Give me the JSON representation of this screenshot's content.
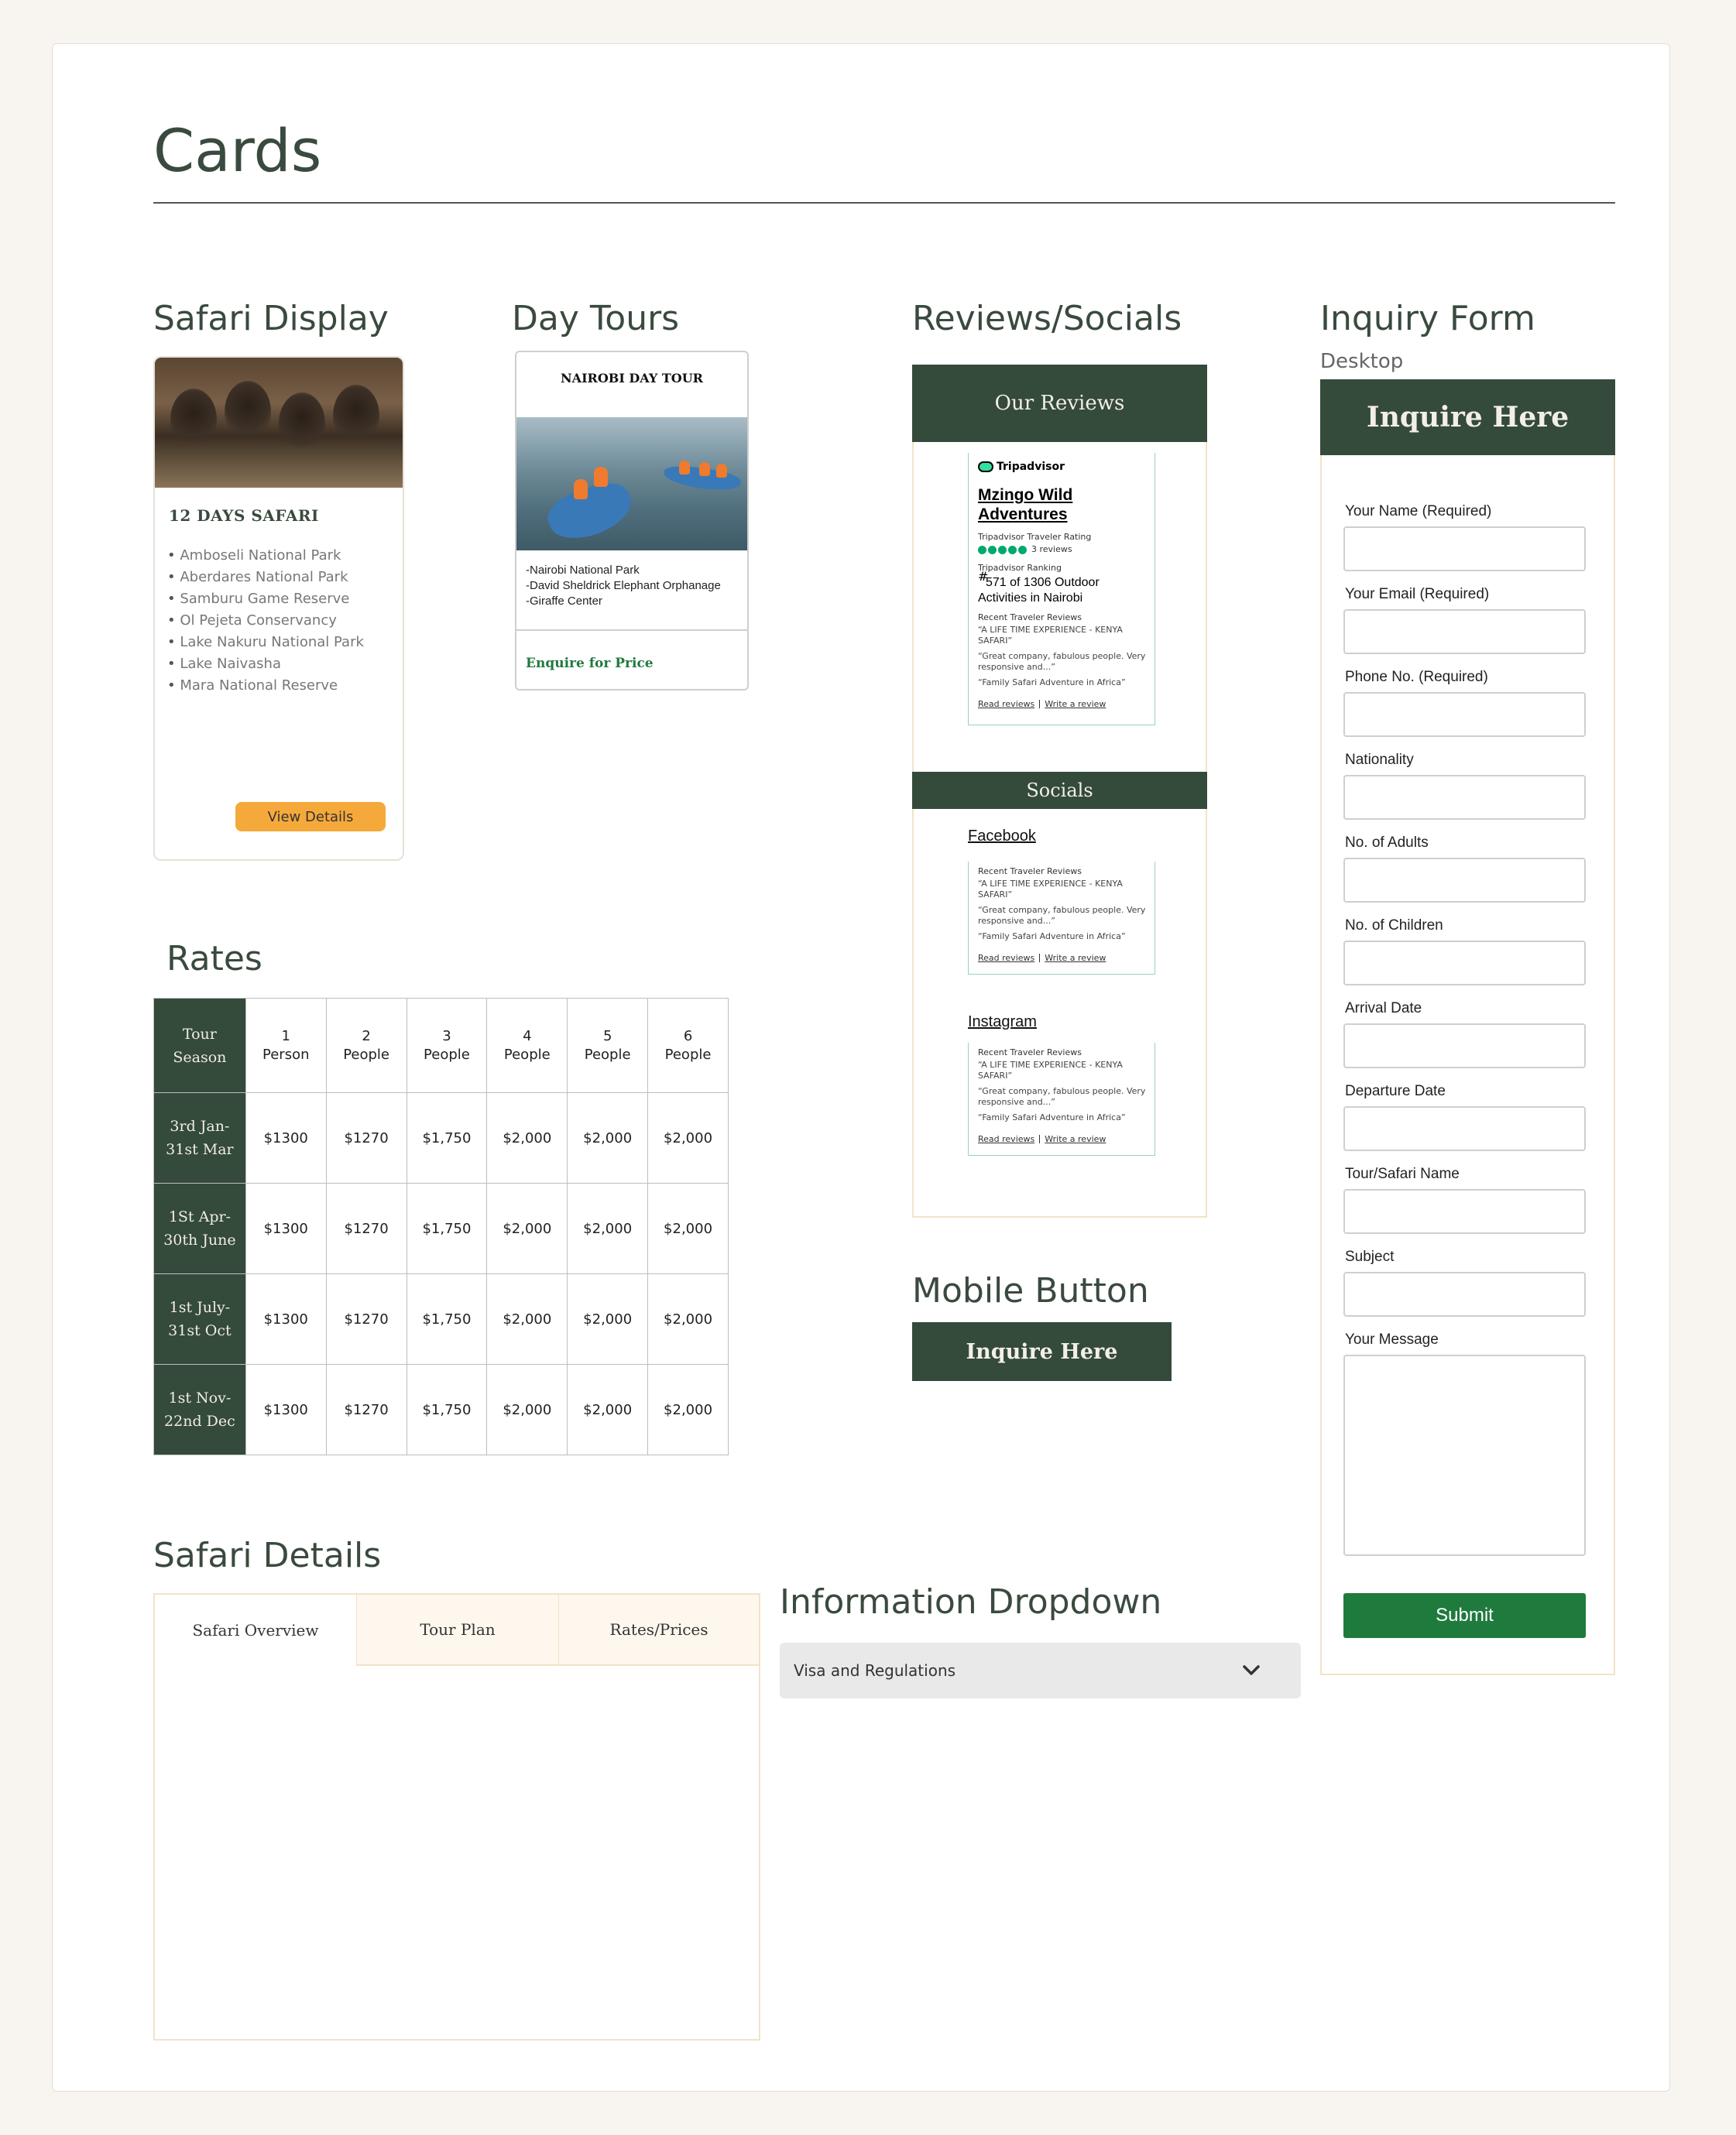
{
  "page": {
    "title": "Cards"
  },
  "safari_display": {
    "heading": "Safari Display",
    "card_title": "12 DAYS SAFARI",
    "items": [
      "Amboseli National Park",
      "Aberdares National Park",
      "Samburu Game Reserve",
      "Ol Pejeta Conservancy",
      "Lake Nakuru National Park",
      "Lake Naivasha",
      "Mara National Reserve"
    ],
    "button_label": "View Details"
  },
  "day_tours": {
    "heading": "Day Tours",
    "card_title": "NAIROBI DAY TOUR",
    "lines": [
      "-Nairobi National Park",
      "-David Sheldrick Elephant Orphanage",
      "-Giraffe Center"
    ],
    "cta": "Enquire for Price"
  },
  "reviews": {
    "heading": "Reviews/Socials",
    "our_reviews": "Our Reviews",
    "socials": "Socials",
    "tripadvisor": {
      "brand": "Tripadvisor",
      "company": "Mzingo Wild Adventures",
      "rating_label": "Tripadvisor Traveler Rating",
      "reviews_count": "3 reviews",
      "ranking_label": "Tripadvisor Ranking",
      "ranking_hash": "#",
      "ranking_text": "571 of 1306 Outdoor Activities in Nairobi",
      "recent_label": "Recent Traveler Reviews",
      "quote1": "“A LIFE TIME EXPERIENCE - KENYA SAFARI”",
      "quote2": "“Great company, fabulous people. Very responsive and...”",
      "quote3": "“Family Safari Adventure in Africa”",
      "read_reviews": "Read reviews",
      "write_review": "Write a review"
    },
    "facebook": "Facebook",
    "instagram": "Instagram"
  },
  "mobile_button": {
    "heading": "Mobile Button",
    "label": "Inquire Here"
  },
  "rates": {
    "heading": "Rates",
    "header_season": "Tour Season",
    "columns": [
      {
        "num": "1",
        "unit": "Person"
      },
      {
        "num": "2",
        "unit": "People"
      },
      {
        "num": "3",
        "unit": "People"
      },
      {
        "num": "4",
        "unit": "People"
      },
      {
        "num": "5",
        "unit": "People"
      },
      {
        "num": "6",
        "unit": "People"
      }
    ],
    "rows": [
      {
        "season_a": "3rd Jan-",
        "season_b": "31st Mar",
        "prices": [
          "$1300",
          "$1270",
          "$1,750",
          "$2,000",
          "$2,000",
          "$2,000"
        ]
      },
      {
        "season_a": "1St Apr-",
        "season_b": "30th June",
        "prices": [
          "$1300",
          "$1270",
          "$1,750",
          "$2,000",
          "$2,000",
          "$2,000"
        ]
      },
      {
        "season_a": "1st July-",
        "season_b": "31st Oct",
        "prices": [
          "$1300",
          "$1270",
          "$1,750",
          "$2,000",
          "$2,000",
          "$2,000"
        ]
      },
      {
        "season_a": "1st Nov-",
        "season_b": "22nd Dec",
        "prices": [
          "$1300",
          "$1270",
          "$1,750",
          "$2,000",
          "$2,000",
          "$2,000"
        ]
      }
    ]
  },
  "inquiry_form": {
    "heading": "Inquiry Form",
    "sub": "Desktop",
    "banner": "Inquire Here",
    "fields": [
      "Your Name (Required)",
      "Your Email (Required)",
      "Phone  No. (Required)",
      "Nationality",
      "No. of Adults",
      "No. of Children",
      "Arrival Date",
      "Departure Date",
      "Tour/Safari Name",
      "Subject"
    ],
    "message_label": "Your Message",
    "submit": "Submit"
  },
  "safari_details": {
    "heading": "Safari Details",
    "tabs": [
      "Safari Overview",
      "Tour Plan",
      "Rates/Prices"
    ]
  },
  "info_dropdown": {
    "heading": "Information Dropdown",
    "selected": "Visa and Regulations"
  },
  "colors": {
    "brand_green": "#344a3b",
    "accent_orange": "#f6a93b",
    "submit_green": "#1f7a3d"
  }
}
